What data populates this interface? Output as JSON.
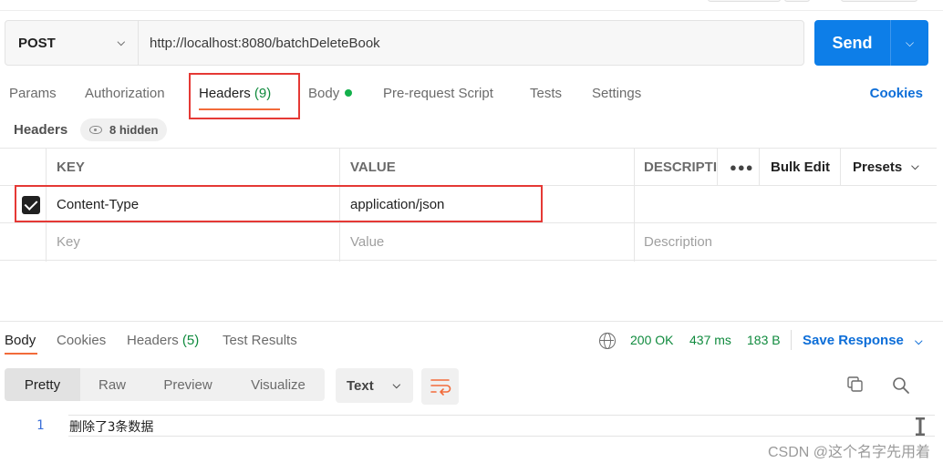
{
  "request": {
    "method": "POST",
    "url": "http://localhost:8080/batchDeleteBook",
    "send_label": "Send"
  },
  "request_tabs": [
    {
      "label": "Params"
    },
    {
      "label": "Authorization"
    },
    {
      "label": "Headers",
      "count": "(9)"
    },
    {
      "label": "Body"
    },
    {
      "label": "Pre-request Script"
    },
    {
      "label": "Tests"
    },
    {
      "label": "Settings"
    }
  ],
  "cookies_link": "Cookies",
  "headers_section": {
    "title": "Headers",
    "hidden_label": "8 hidden"
  },
  "table": {
    "columns": {
      "key": "KEY",
      "value": "VALUE",
      "description": "DESCRIPTI"
    },
    "bulk_edit": "Bulk Edit",
    "presets": "Presets",
    "rows": [
      {
        "key": "Content-Type",
        "value": "application/json",
        "description": "",
        "checked": true
      }
    ],
    "placeholders": {
      "key": "Key",
      "value": "Value",
      "description": "Description"
    }
  },
  "response": {
    "tabs": [
      {
        "label": "Body"
      },
      {
        "label": "Cookies"
      },
      {
        "label": "Headers",
        "count": "(5)"
      },
      {
        "label": "Test Results"
      }
    ],
    "status": "200 OK",
    "time": "437 ms",
    "size": "183 B",
    "save_label": "Save Response",
    "formats": [
      "Pretty",
      "Raw",
      "Preview",
      "Visualize"
    ],
    "type_label": "Text",
    "lines": [
      {
        "no": "1",
        "text": "删除了3条数据"
      }
    ]
  },
  "watermark": "CSDN @这个名字先用着",
  "colors": {
    "accent": "#0d7ee8",
    "tab_underline": "#f26b3a",
    "success": "#0f8a3d",
    "highlight_box": "#e53935"
  }
}
